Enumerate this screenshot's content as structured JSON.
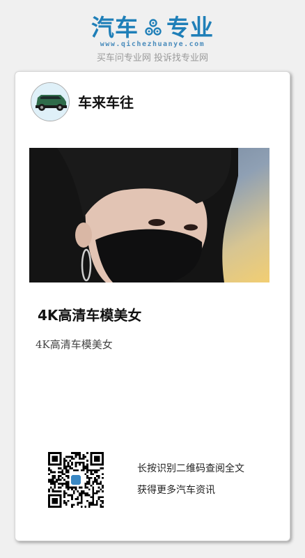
{
  "header": {
    "logo_left": "汽车",
    "logo_right": "专业",
    "logo_url": "www.qichezhuanye.com",
    "tagline": "买车问专业网 投诉找专业网",
    "brand_color": "#1f7fb8",
    "logo_icon": "gear-icon"
  },
  "card": {
    "account_name": "车来车往",
    "avatar_icon": "car-icon",
    "article_title": "4K高清车模美女",
    "article_summary": "4K高清车模美女",
    "qr_hint_line1": "长按识别二维码查阅全文",
    "qr_hint_line2": "获得更多汽车资讯"
  }
}
